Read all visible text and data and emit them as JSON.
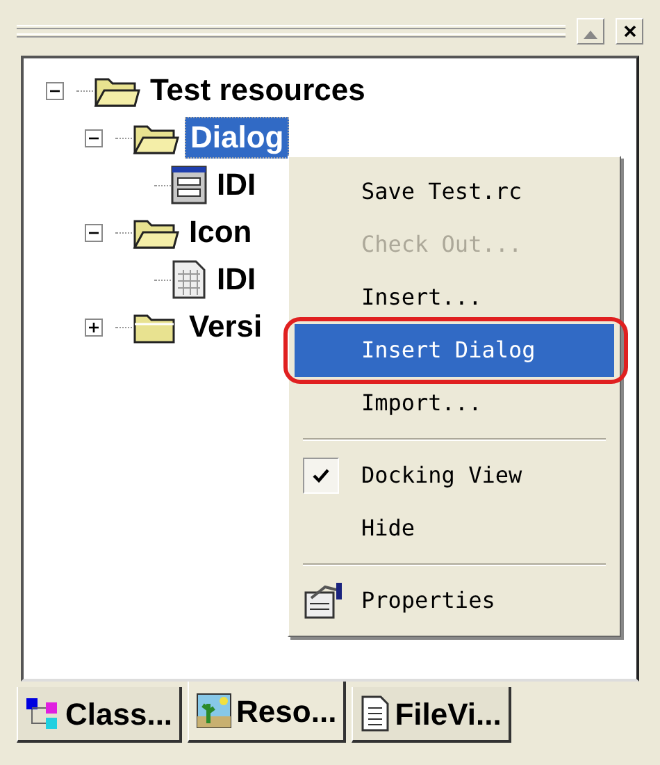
{
  "tree": [
    {
      "label": "Test resources",
      "kind": "folder",
      "expanded": true,
      "selected": false,
      "children": [
        {
          "label": "Dialog",
          "kind": "folder",
          "expanded": true,
          "selected": true,
          "children": [
            {
              "label": "IDI",
              "kind": "dialog",
              "selected": false
            }
          ]
        },
        {
          "label": "Icon",
          "kind": "folder",
          "expanded": true,
          "selected": false,
          "children": [
            {
              "label": "IDI",
              "kind": "icon",
              "selected": false
            }
          ]
        },
        {
          "label": "Versi",
          "kind": "folder",
          "expanded": false,
          "selected": false
        }
      ]
    }
  ],
  "context_menu": [
    {
      "kind": "item",
      "label": "Save Test.rc",
      "disabled": false,
      "selected": false,
      "checked": false
    },
    {
      "kind": "item",
      "label": "Check Out...",
      "disabled": true,
      "selected": false,
      "checked": false
    },
    {
      "kind": "item",
      "label": "Insert...",
      "disabled": false,
      "selected": false,
      "checked": false
    },
    {
      "kind": "item",
      "label": "Insert Dialog",
      "disabled": false,
      "selected": true,
      "checked": false,
      "annotated": true
    },
    {
      "kind": "item",
      "label": "Import...",
      "disabled": false,
      "selected": false,
      "checked": false
    },
    {
      "kind": "separator"
    },
    {
      "kind": "item",
      "label": "Docking View",
      "disabled": false,
      "selected": false,
      "checked": true
    },
    {
      "kind": "item",
      "label": "Hide",
      "disabled": false,
      "selected": false,
      "checked": false
    },
    {
      "kind": "separator"
    },
    {
      "kind": "icon_item",
      "label": "Properties",
      "disabled": false,
      "selected": false,
      "checked": false
    }
  ],
  "tabs": [
    {
      "label": "Class...",
      "selected": false
    },
    {
      "label": "Reso...",
      "selected": true
    },
    {
      "label": "FileVi...",
      "selected": false
    }
  ]
}
